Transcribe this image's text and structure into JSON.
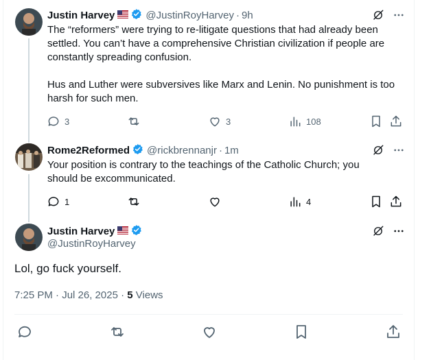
{
  "tweet1": {
    "name": "Justin Harvey",
    "handle": "@JustinRoyHarvey",
    "time": "9h",
    "line1": "The “reformers” were trying to re-litigate questions that had already been",
    "line2": "settled. You can’t have a comprehensive Christian civilization if people are",
    "line3": "constantly spreading confusion.",
    "line4": "Hus and Luther were subversives like Marx and Lenin. No punishment is too",
    "line5": "harsh for such men.",
    "replies": "3",
    "likes": "3",
    "views": "108"
  },
  "tweet2": {
    "name": "Rome2Reformed",
    "handle": "@rickbrennanjr",
    "time": "1m",
    "line1": "Your position is contrary to the teachings of the Catholic Church; you",
    "line2": "should be excommunicated.",
    "replies": "1",
    "views": "4"
  },
  "main": {
    "name": "Justin Harvey",
    "handle": "@JustinRoyHarvey",
    "text": "Lol, go fuck yourself.",
    "timestamp": "7:25 PM · Jul 26, 2025",
    "sep": "·",
    "views_count": "5",
    "views_label": "Views"
  },
  "icons": [
    "reply-icon",
    "retweet-icon",
    "like-icon",
    "views-icon",
    "bookmark-icon",
    "share-icon",
    "grok-icon",
    "more-icon",
    "verified-icon",
    "us-flag-icon"
  ],
  "colors": {
    "verified": "#1d9bf0",
    "text": "#0f1419",
    "muted": "#536471",
    "line": "#cfd9de"
  }
}
